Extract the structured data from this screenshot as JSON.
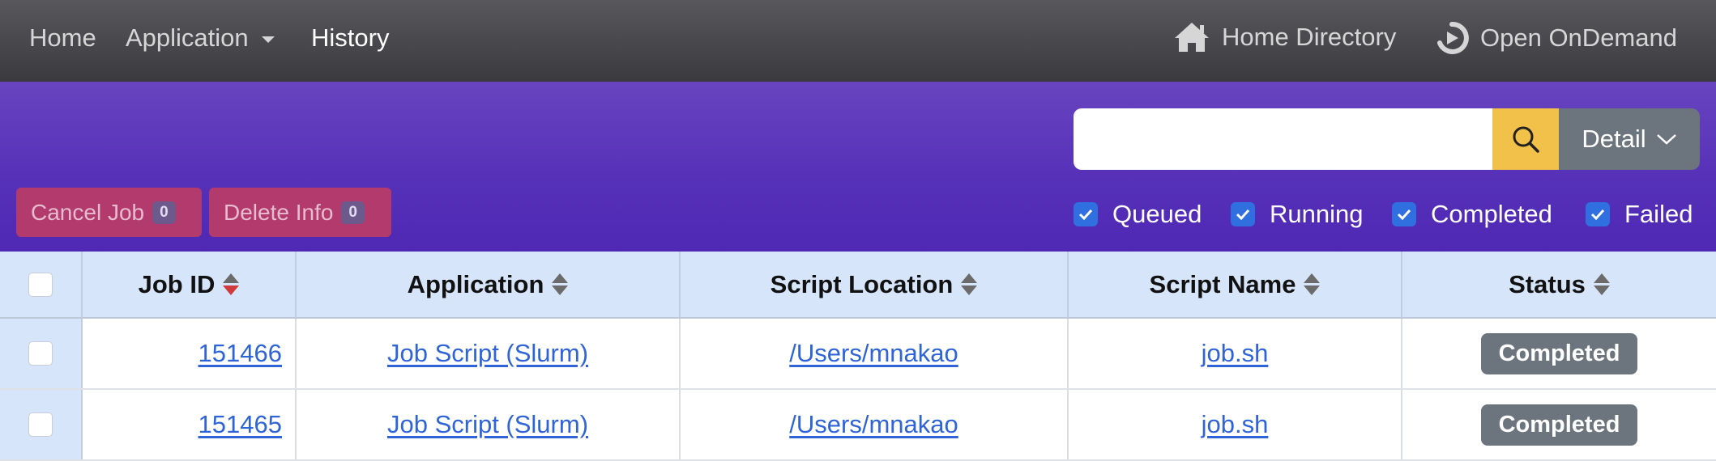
{
  "navbar": {
    "home": "Home",
    "application": "Application",
    "history": "History",
    "home_directory": "Home Directory",
    "open_ondemand": "Open OnDemand"
  },
  "toolbar": {
    "search": {
      "value": "",
      "placeholder": ""
    },
    "detail_label": "Detail",
    "cancel_job": {
      "label": "Cancel Job",
      "count": "0"
    },
    "delete_info": {
      "label": "Delete Info",
      "count": "0"
    },
    "filters": [
      {
        "label": "Queued",
        "checked": true
      },
      {
        "label": "Running",
        "checked": true
      },
      {
        "label": "Completed",
        "checked": true
      },
      {
        "label": "Failed",
        "checked": true
      }
    ]
  },
  "table": {
    "columns": [
      "Job ID",
      "Application",
      "Script Location",
      "Script Name",
      "Status"
    ],
    "sorted_column": "Job ID",
    "rows": [
      {
        "job_id": "151466",
        "application": "Job Script (Slurm)",
        "location": "/Users/mnakao",
        "name": "job.sh",
        "status": "Completed"
      },
      {
        "job_id": "151465",
        "application": "Job Script (Slurm)",
        "location": "/Users/mnakao",
        "name": "job.sh",
        "status": "Completed"
      }
    ]
  },
  "colors": {
    "navbar": "#47464a",
    "band": "#5a36bb",
    "search_button": "#f2c14a",
    "action_button": "#b23a6c",
    "checkbox": "#2f6fe0",
    "header_row": "#d7e5fb",
    "link": "#2f63d8",
    "status_badge": "#6c757d"
  },
  "icons": {
    "home_directory": "house-icon",
    "open_ondemand": "ondemand-logo-icon",
    "search": "magnifier-icon",
    "detail": "chevron-down-icon",
    "sort": "sort-icon"
  }
}
